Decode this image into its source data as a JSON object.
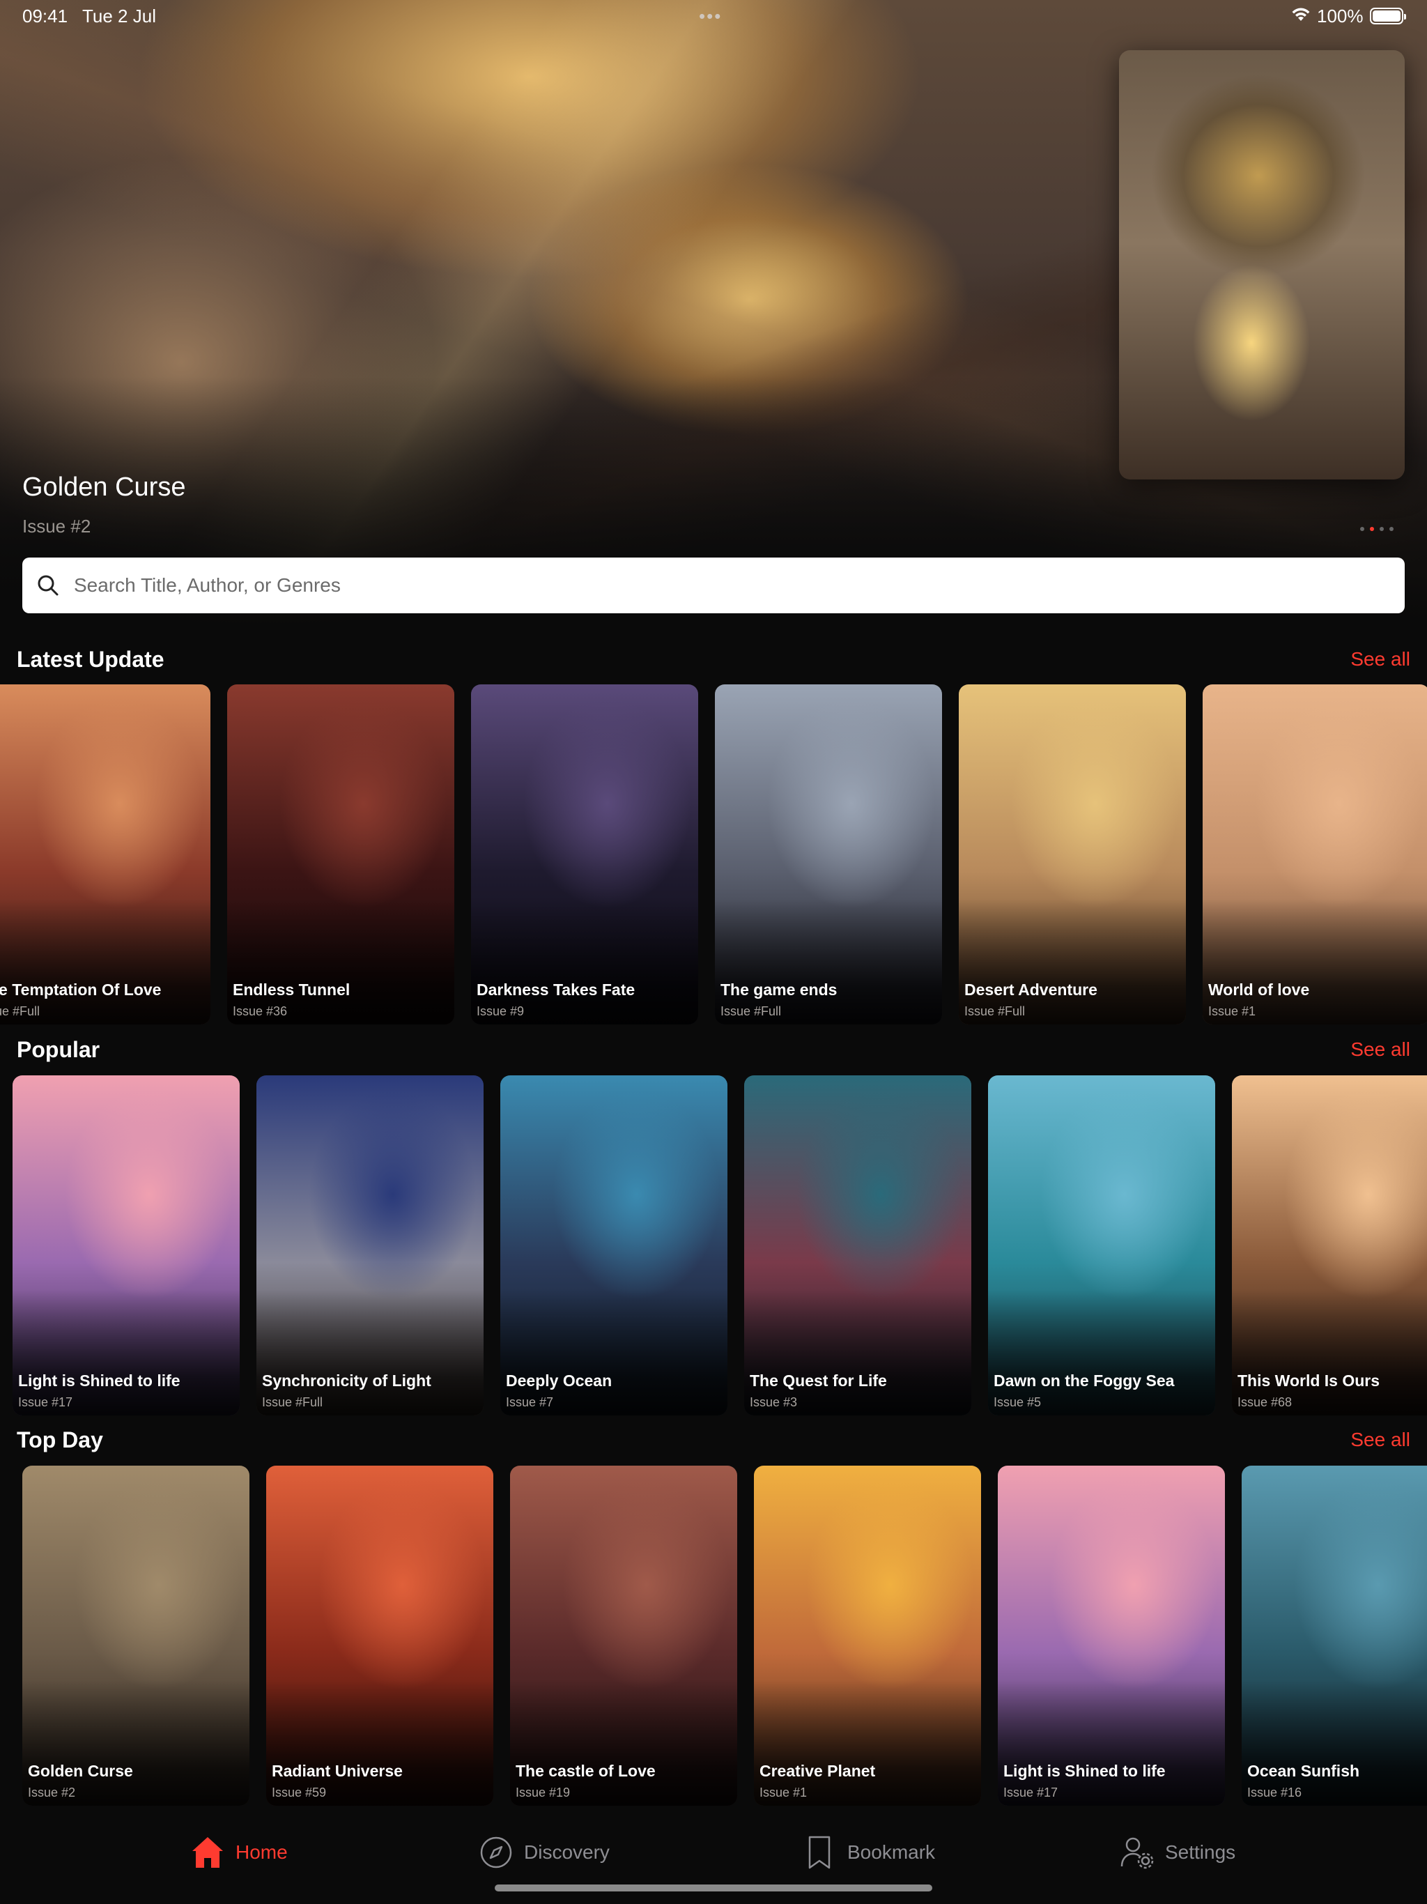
{
  "status_bar": {
    "time": "09:41",
    "date": "Tue 2 Jul",
    "battery": "100%"
  },
  "hero": {
    "title": "Golden Curse",
    "issue": "Issue #2"
  },
  "search": {
    "placeholder": "Search Title, Author, or Genres"
  },
  "sections": [
    {
      "title": "Latest Update",
      "see_all": "See all",
      "items": [
        {
          "title": "he Temptation Of Love",
          "issue": "sue #Full",
          "colors": [
            "#d98c5c",
            "#8b3a2a",
            "#2c1814"
          ]
        },
        {
          "title": "Endless Tunnel",
          "issue": "Issue #36",
          "colors": [
            "#8a3a2e",
            "#3b1414",
            "#140808"
          ]
        },
        {
          "title": "Darkness Takes Fate",
          "issue": "Issue #9",
          "colors": [
            "#5a4a7a",
            "#1e1a2e",
            "#0d0b14"
          ]
        },
        {
          "title": "The game ends",
          "issue": "Issue #Full",
          "colors": [
            "#9aa4b4",
            "#5a5f6e",
            "#1a1a22"
          ]
        },
        {
          "title": "Desert Adventure",
          "issue": "Issue #Full",
          "colors": [
            "#e6c27a",
            "#b88a5c",
            "#4a3020"
          ]
        },
        {
          "title": "World of love",
          "issue": "Issue #1",
          "colors": [
            "#e8b48a",
            "#c4906a",
            "#5a3e2c"
          ]
        }
      ]
    },
    {
      "title": "Popular",
      "see_all": "See all",
      "items": [
        {
          "title": "Light is Shined to life",
          "issue": "Issue #17",
          "colors": [
            "#f0a0b0",
            "#9a6ab0",
            "#2a2440"
          ]
        },
        {
          "title": "Synchronicity of Light",
          "issue": "Issue #Full",
          "colors": [
            "#2a3a7a",
            "#8a8a9a",
            "#3a3028"
          ]
        },
        {
          "title": "Deeply Ocean",
          "issue": "Issue #7",
          "colors": [
            "#3a8ab0",
            "#2a3a5a",
            "#101a24"
          ]
        },
        {
          "title": "The Quest for Life",
          "issue": "Issue #3",
          "colors": [
            "#2a6a7a",
            "#7a3a4a",
            "#141a24"
          ]
        },
        {
          "title": "Dawn on the Foggy Sea",
          "issue": "Issue #5",
          "colors": [
            "#6ab8d0",
            "#2a8a9a",
            "#1a3a44"
          ]
        },
        {
          "title": "This World Is Ours",
          "issue": "Issue #68",
          "colors": [
            "#f0c090",
            "#8a5a3a",
            "#2a1a14"
          ]
        }
      ]
    },
    {
      "title": "Top Day",
      "see_all": "See all",
      "items": [
        {
          "title": "Golden Curse",
          "issue": "Issue #2",
          "colors": [
            "#a08a6a",
            "#6a5a48",
            "#2a221c"
          ]
        },
        {
          "title": "Radiant Universe",
          "issue": "Issue #59",
          "colors": [
            "#e0603a",
            "#8a2a1a",
            "#2a0e0a"
          ]
        },
        {
          "title": "The castle of Love",
          "issue": "Issue #19",
          "colors": [
            "#a05a4a",
            "#5a2a2a",
            "#1e1010"
          ]
        },
        {
          "title": "Creative Planet",
          "issue": "Issue #1",
          "colors": [
            "#f0b040",
            "#c06a3a",
            "#3a2418"
          ]
        },
        {
          "title": "Light is Shined to life",
          "issue": "Issue #17",
          "colors": [
            "#f0a0b0",
            "#9a6ab0",
            "#2a2440"
          ]
        },
        {
          "title": "Ocean Sunfish",
          "issue": "Issue #16",
          "colors": [
            "#5a9ab0",
            "#2a5a6a",
            "#101e24"
          ]
        }
      ]
    }
  ],
  "tabbar": {
    "home": "Home",
    "discovery": "Discovery",
    "bookmark": "Bookmark",
    "settings": "Settings"
  },
  "colors": {
    "accent": "#ff3b30",
    "background": "#0a0a0a",
    "inactive": "#8e8e93"
  },
  "icons": [
    "search-icon",
    "wifi-icon",
    "battery-icon",
    "home-icon",
    "compass-icon",
    "bookmark-icon",
    "settings-gear-icon"
  ]
}
